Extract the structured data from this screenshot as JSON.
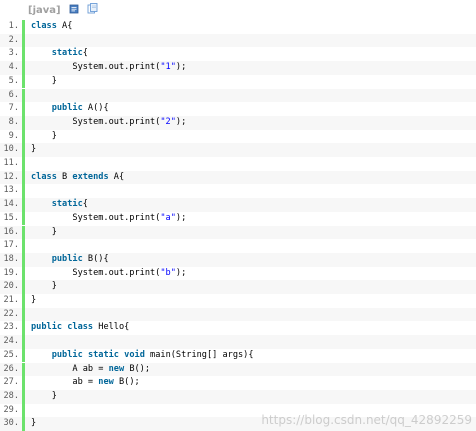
{
  "toolbar": {
    "language_label": "[java]"
  },
  "watermark": "https://blog.csdn.net/qq_42892259",
  "lines": [
    {
      "num": "1.",
      "tokens": [
        {
          "t": "kw",
          "v": "class"
        },
        {
          "t": "p",
          "v": " A{"
        }
      ]
    },
    {
      "num": "2.",
      "tokens": []
    },
    {
      "num": "3.",
      "tokens": [
        {
          "t": "p",
          "v": "    "
        },
        {
          "t": "kw",
          "v": "static"
        },
        {
          "t": "p",
          "v": "{"
        }
      ]
    },
    {
      "num": "4.",
      "tokens": [
        {
          "t": "p",
          "v": "        System.out.print("
        },
        {
          "t": "str",
          "v": "\"1\""
        },
        {
          "t": "p",
          "v": ");"
        }
      ]
    },
    {
      "num": "5.",
      "tokens": [
        {
          "t": "p",
          "v": "    }"
        }
      ]
    },
    {
      "num": "6.",
      "tokens": []
    },
    {
      "num": "7.",
      "tokens": [
        {
          "t": "p",
          "v": "    "
        },
        {
          "t": "kw",
          "v": "public"
        },
        {
          "t": "p",
          "v": " A(){"
        }
      ]
    },
    {
      "num": "8.",
      "tokens": [
        {
          "t": "p",
          "v": "        System.out.print("
        },
        {
          "t": "str",
          "v": "\"2\""
        },
        {
          "t": "p",
          "v": ");"
        }
      ]
    },
    {
      "num": "9.",
      "tokens": [
        {
          "t": "p",
          "v": "    }"
        }
      ]
    },
    {
      "num": "10.",
      "tokens": [
        {
          "t": "p",
          "v": "}"
        }
      ]
    },
    {
      "num": "11.",
      "tokens": []
    },
    {
      "num": "12.",
      "tokens": [
        {
          "t": "kw",
          "v": "class"
        },
        {
          "t": "p",
          "v": " B "
        },
        {
          "t": "kw",
          "v": "extends"
        },
        {
          "t": "p",
          "v": " A{"
        }
      ]
    },
    {
      "num": "13.",
      "tokens": []
    },
    {
      "num": "14.",
      "tokens": [
        {
          "t": "p",
          "v": "    "
        },
        {
          "t": "kw",
          "v": "static"
        },
        {
          "t": "p",
          "v": "{"
        }
      ]
    },
    {
      "num": "15.",
      "tokens": [
        {
          "t": "p",
          "v": "        System.out.print("
        },
        {
          "t": "str",
          "v": "\"a\""
        },
        {
          "t": "p",
          "v": ");"
        }
      ]
    },
    {
      "num": "16.",
      "tokens": [
        {
          "t": "p",
          "v": "    }"
        }
      ]
    },
    {
      "num": "17.",
      "tokens": []
    },
    {
      "num": "18.",
      "tokens": [
        {
          "t": "p",
          "v": "    "
        },
        {
          "t": "kw",
          "v": "public"
        },
        {
          "t": "p",
          "v": " B(){"
        }
      ]
    },
    {
      "num": "19.",
      "tokens": [
        {
          "t": "p",
          "v": "        System.out.print("
        },
        {
          "t": "str",
          "v": "\"b\""
        },
        {
          "t": "p",
          "v": ");"
        }
      ]
    },
    {
      "num": "20.",
      "tokens": [
        {
          "t": "p",
          "v": "    }"
        }
      ]
    },
    {
      "num": "21.",
      "tokens": [
        {
          "t": "p",
          "v": "}"
        }
      ]
    },
    {
      "num": "22.",
      "tokens": []
    },
    {
      "num": "23.",
      "tokens": [
        {
          "t": "kw",
          "v": "public"
        },
        {
          "t": "p",
          "v": " "
        },
        {
          "t": "kw",
          "v": "class"
        },
        {
          "t": "p",
          "v": " Hello{"
        }
      ]
    },
    {
      "num": "24.",
      "tokens": []
    },
    {
      "num": "25.",
      "tokens": [
        {
          "t": "p",
          "v": "    "
        },
        {
          "t": "kw",
          "v": "public"
        },
        {
          "t": "p",
          "v": " "
        },
        {
          "t": "kw",
          "v": "static"
        },
        {
          "t": "p",
          "v": " "
        },
        {
          "t": "kw",
          "v": "void"
        },
        {
          "t": "p",
          "v": " main(String[] args){"
        }
      ]
    },
    {
      "num": "26.",
      "tokens": [
        {
          "t": "p",
          "v": "        A ab = "
        },
        {
          "t": "kw",
          "v": "new"
        },
        {
          "t": "p",
          "v": " B();"
        }
      ]
    },
    {
      "num": "27.",
      "tokens": [
        {
          "t": "p",
          "v": "        ab = "
        },
        {
          "t": "kw",
          "v": "new"
        },
        {
          "t": "p",
          "v": " B();"
        }
      ]
    },
    {
      "num": "28.",
      "tokens": [
        {
          "t": "p",
          "v": "    }"
        }
      ]
    },
    {
      "num": "29.",
      "tokens": []
    },
    {
      "num": "30.",
      "tokens": [
        {
          "t": "p",
          "v": "}"
        }
      ]
    }
  ]
}
